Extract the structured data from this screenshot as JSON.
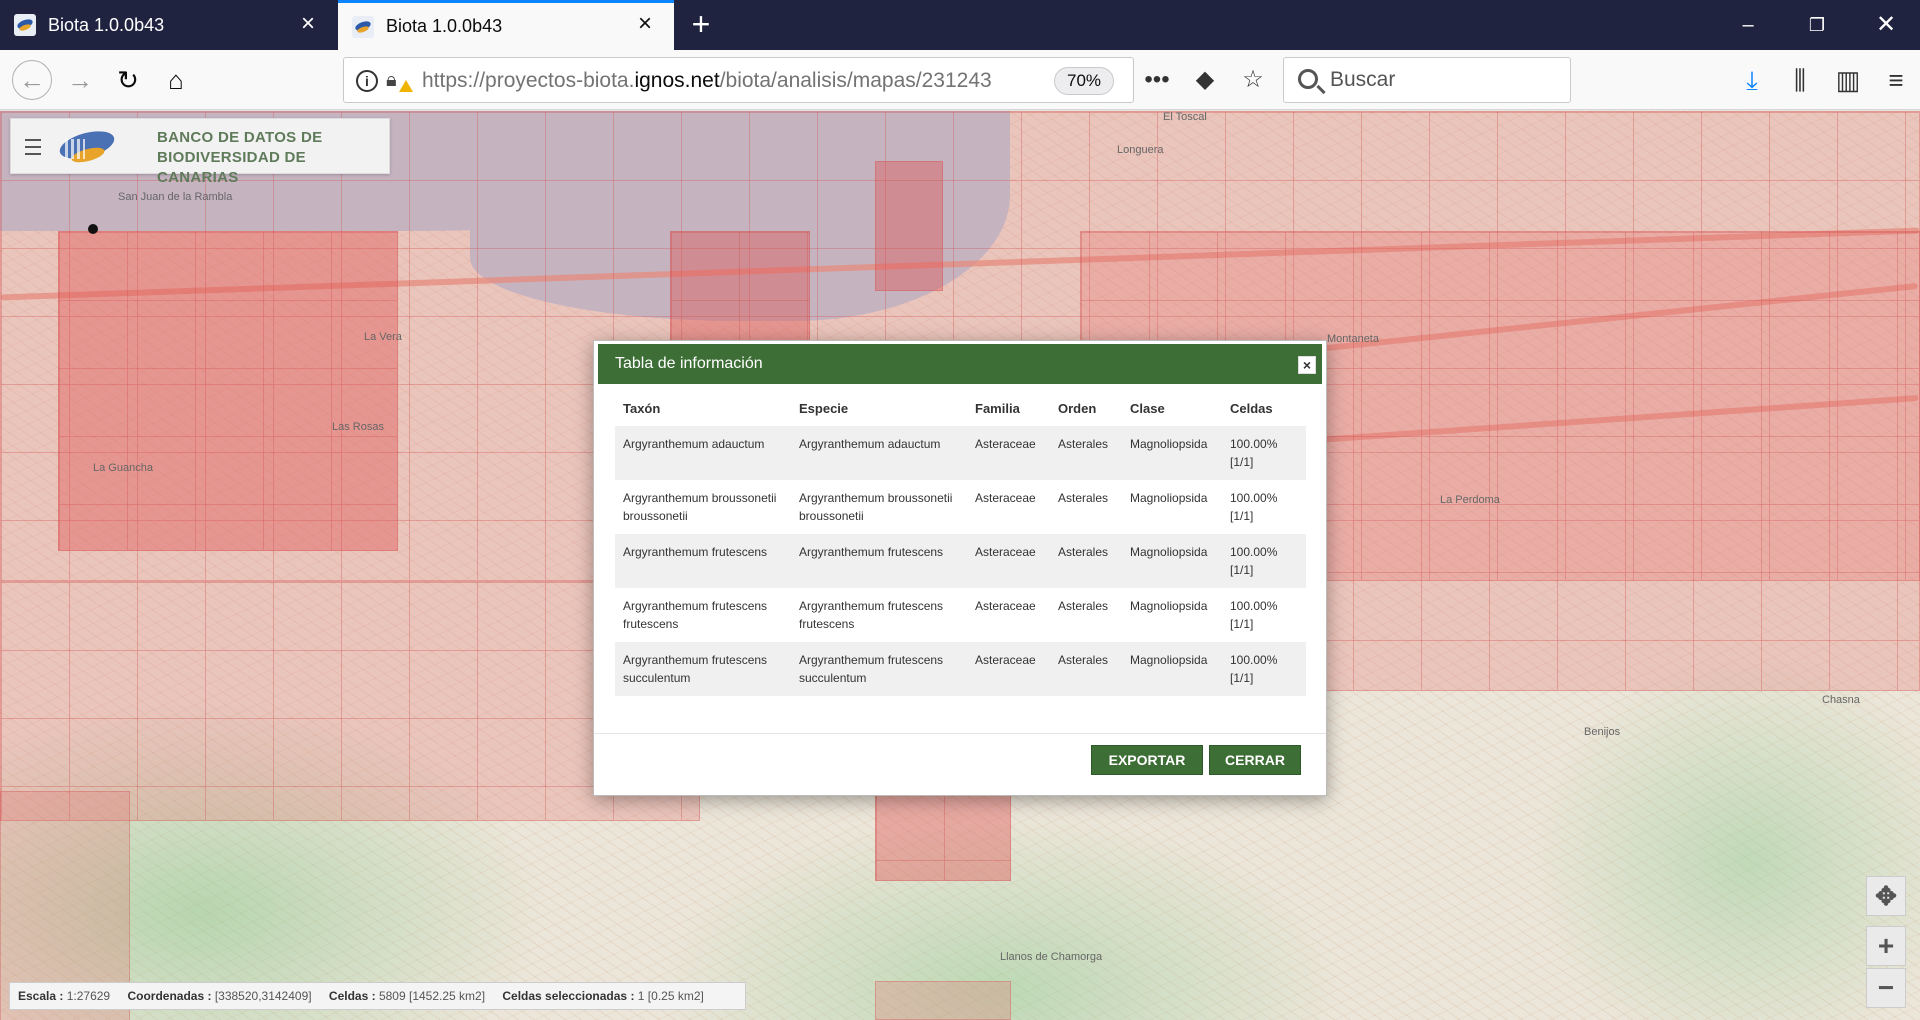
{
  "browser": {
    "tabs": [
      {
        "title": "Biota 1.0.0b43",
        "active": false
      },
      {
        "title": "Biota 1.0.0b43",
        "active": true
      }
    ],
    "url_prefix": "https://proyectos-biota.",
    "url_host": "ignos.net",
    "url_path": "/biota/analisis/mapas/231243",
    "zoom": "70%",
    "search_placeholder": "Buscar"
  },
  "app": {
    "logo_line1": "BANCO DE DATOS DE",
    "logo_line2": "BIODIVERSIDAD DE CANARIAS"
  },
  "map": {
    "places": [
      {
        "name": "San Juan de la Rambla"
      },
      {
        "name": "La Vera"
      },
      {
        "name": "Las Rosas"
      },
      {
        "name": "La Guancha"
      },
      {
        "name": "El Toscal"
      },
      {
        "name": "Longuera"
      },
      {
        "name": "Montaneta"
      },
      {
        "name": "La Perdoma"
      },
      {
        "name": "Benijos"
      },
      {
        "name": "Chasna"
      },
      {
        "name": "Llanos de Chamorga"
      }
    ]
  },
  "status": {
    "escala_label": "Escala :",
    "escala_value": "1:27629",
    "coord_label": "Coordenadas :",
    "coord_value": "[338520,3142409]",
    "celdas_label": "Celdas :",
    "celdas_value": "5809 [1452.25 km2]",
    "sel_label": "Celdas seleccionadas :",
    "sel_value": "1 [0.25 km2]"
  },
  "modal": {
    "title": "Tabla de información",
    "columns": [
      "Taxón",
      "Especie",
      "Familia",
      "Orden",
      "Clase",
      "Celdas"
    ],
    "rows": [
      {
        "taxon": "Argyranthemum adauctum",
        "especie": "Argyranthemum adauctum",
        "familia": "Asteraceae",
        "orden": "Asterales",
        "clase": "Magnoliopsida",
        "celdas": "100.00%",
        "celdas2": "[1/1]"
      },
      {
        "taxon": "Argyranthemum broussonetii broussonetii",
        "especie": "Argyranthemum broussonetii broussonetii",
        "familia": "Asteraceae",
        "orden": "Asterales",
        "clase": "Magnoliopsida",
        "celdas": "100.00%",
        "celdas2": "[1/1]"
      },
      {
        "taxon": "Argyranthemum frutescens",
        "especie": "Argyranthemum frutescens",
        "familia": "Asteraceae",
        "orden": "Asterales",
        "clase": "Magnoliopsida",
        "celdas": "100.00%",
        "celdas2": "[1/1]"
      },
      {
        "taxon": "Argyranthemum frutescens frutescens",
        "especie": "Argyranthemum frutescens frutescens",
        "familia": "Asteraceae",
        "orden": "Asterales",
        "clase": "Magnoliopsida",
        "celdas": "100.00%",
        "celdas2": "[1/1]"
      },
      {
        "taxon": "Argyranthemum frutescens succulentum",
        "especie": "Argyranthemum frutescens succulentum",
        "familia": "Asteraceae",
        "orden": "Asterales",
        "clase": "Magnoliopsida",
        "celdas": "100.00%",
        "celdas2": "[1/1]"
      }
    ],
    "export_label": "EXPORTAR",
    "close_label": "CERRAR"
  },
  "colors": {
    "header_green": "#3c6e35",
    "tabbar": "#202340",
    "grid_red": "#e06e6e"
  }
}
